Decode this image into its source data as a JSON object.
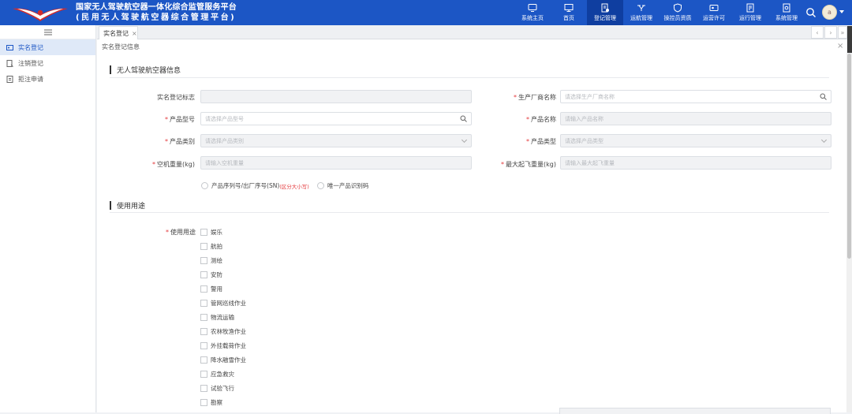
{
  "header": {
    "title_line1": "国家无人驾驶航空器一体化综合监管服务平台",
    "title_line2": "(民用无人驾驶航空器综合管理平台)",
    "nav": [
      {
        "label": "系统主页",
        "icon": "dashboard-icon"
      },
      {
        "label": "首页",
        "icon": "monitor-icon"
      },
      {
        "label": "登记管理",
        "icon": "register-icon",
        "active": true
      },
      {
        "label": "运航管理",
        "icon": "drone-icon"
      },
      {
        "label": "操控员资质",
        "icon": "shield-icon"
      },
      {
        "label": "运营许可",
        "icon": "card-icon"
      },
      {
        "label": "运行管理",
        "icon": "document-icon"
      },
      {
        "label": "系统管理",
        "icon": "settings-icon"
      }
    ],
    "avatar_text": "a",
    "accent": "#1c56c5"
  },
  "sidebar": {
    "items": [
      {
        "label": "实名登记",
        "active": true
      },
      {
        "label": "注销登记",
        "active": false
      },
      {
        "label": "拒注申请",
        "active": false
      }
    ]
  },
  "tabs": [
    {
      "label": "实名登记"
    }
  ],
  "breadcrumb": "实名登记信息",
  "section1": "无人驾驶航空器信息",
  "form": {
    "reg_id_label": "实名登记标志",
    "manufacturer_label": "生产厂商名称",
    "manufacturer_placeholder": "请选择生产厂商名称",
    "model_label": "产品型号",
    "model_placeholder": "请选择产品型号",
    "product_name_label": "产品名称",
    "product_name_placeholder": "请输入产品名称",
    "category_label": "产品类别",
    "category_placeholder": "请选择产品类别",
    "type_label": "产品类型",
    "type_placeholder": "请选择产品类型",
    "empty_weight_label": "空机重量(kg)",
    "empty_weight_placeholder": "请输入空机重量",
    "max_takeoff_label": "最大起飞重量(kg)",
    "max_takeoff_placeholder": "请输入最大起飞重量",
    "sn_option": "产品序列号/出厂序号(SN)",
    "sn_note": "(区分大小写)",
    "uid_option": "唯一产品识别码"
  },
  "section2": "使用用途",
  "usage": {
    "label": "使用用途",
    "options": [
      "娱乐",
      "航拍",
      "测绘",
      "安防",
      "警用",
      "管网巡线作业",
      "物流运输",
      "农林牧渔作业",
      "外挂载荷作业",
      "降水融雪作业",
      "应急救灾",
      "试验飞行",
      "勘察"
    ]
  }
}
